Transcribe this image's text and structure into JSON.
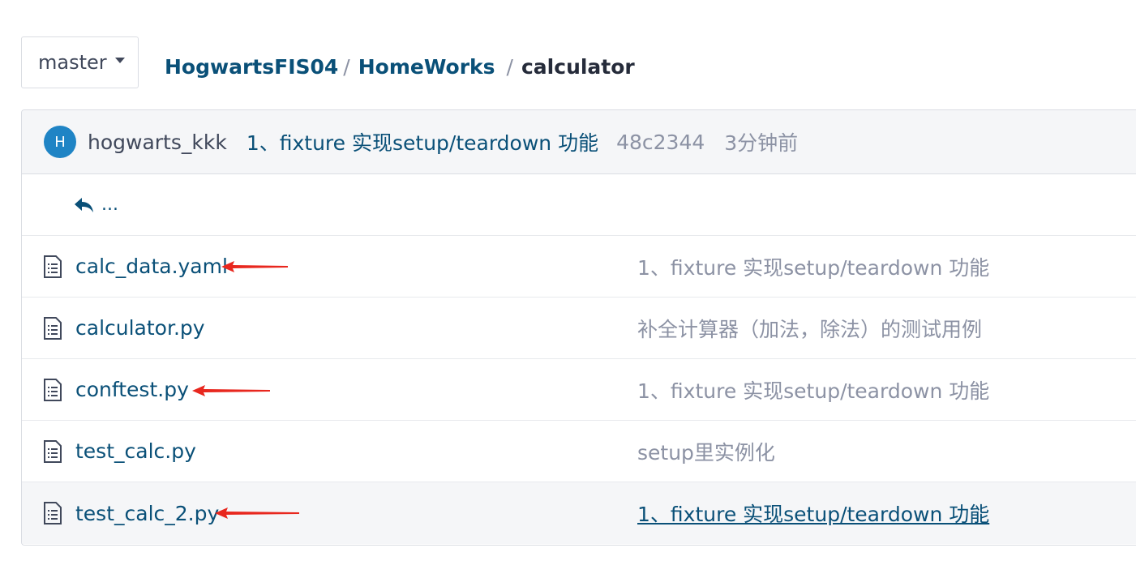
{
  "branch": {
    "label": "master"
  },
  "breadcrumb": {
    "owner": "HogwartsFIS04",
    "repo": "HomeWorks",
    "folder": "calculator",
    "sep": "/"
  },
  "commit": {
    "avatar_letter": "H",
    "author": "hogwarts_kkk",
    "message": "1、fixture 实现setup/teardown 功能",
    "sha": "48c2344",
    "time": "3分钟前"
  },
  "up": {
    "label": "..."
  },
  "files": [
    {
      "name": "calc_data.yaml",
      "message": "1、fixture 实现setup/teardown 功能"
    },
    {
      "name": "calculator.py",
      "message": "补全计算器（加法，除法）的测试用例"
    },
    {
      "name": "conftest.py",
      "message": "1、fixture 实现setup/teardown 功能"
    },
    {
      "name": "test_calc.py",
      "message": "setup里实例化"
    },
    {
      "name": "test_calc_2.py",
      "message": "1、fixture 实现setup/teardown 功能"
    }
  ],
  "colors": {
    "link": "#0a5078",
    "muted": "#8c92a4",
    "avatar": "#1f84c5",
    "annotation_arrow": "#e8271e"
  }
}
